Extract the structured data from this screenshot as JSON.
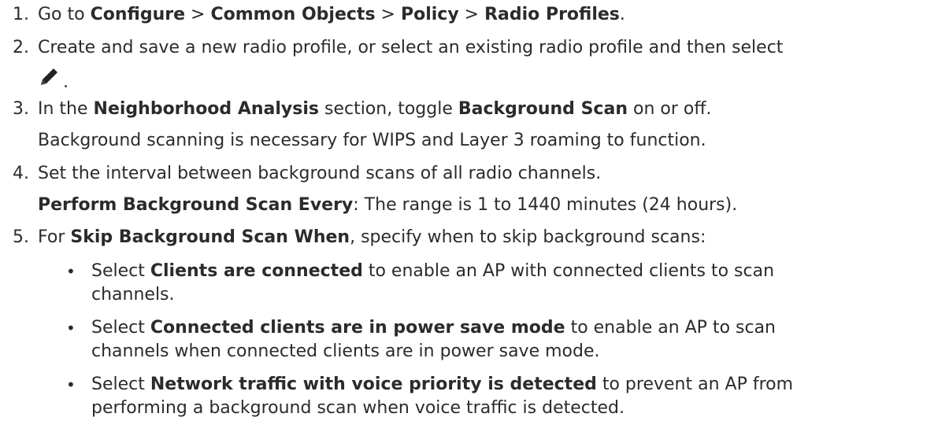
{
  "steps": [
    {
      "number": "1.",
      "parts": [
        "Go to ",
        "Configure",
        " > ",
        "Common Objects",
        " > ",
        "Policy",
        " > ",
        "Radio Profiles",
        "."
      ]
    },
    {
      "number": "2.",
      "line1": "Create and save a new radio profile, or select an existing radio profile and then select",
      "after_icon": ".",
      "icon": "pencil-edit-icon"
    },
    {
      "number": "3.",
      "parts": [
        "In the ",
        "Neighborhood Analysis",
        " section, toggle ",
        "Background Scan",
        " on or off."
      ],
      "note": "Background scanning is necessary for WIPS and Layer 3 roaming to function."
    },
    {
      "number": "4.",
      "text": "Set the interval between background scans of all radio channels.",
      "detail_label": "Perform Background Scan Every",
      "detail_text": ": The range is 1 to 1440 minutes (24 hours)."
    },
    {
      "number": "5.",
      "parts": [
        "For ",
        "Skip Background Scan When",
        ", specify when to skip background scans:"
      ],
      "bullets": [
        {
          "pre": "Select ",
          "bold": "Clients are connected",
          "post": " to enable an AP with connected clients to scan",
          "cont": "channels."
        },
        {
          "pre": "Select ",
          "bold": "Connected clients are in power save mode",
          "post": " to enable an AP to scan",
          "cont": "channels when connected clients are in power save mode."
        },
        {
          "pre": "Select ",
          "bold": "Network traffic with voice priority is detected",
          "post": " to prevent an AP from",
          "cont": "performing a background scan when voice traffic is detected."
        }
      ]
    }
  ],
  "colors": {
    "text": "#2b2b2b",
    "icon": "#222222"
  }
}
